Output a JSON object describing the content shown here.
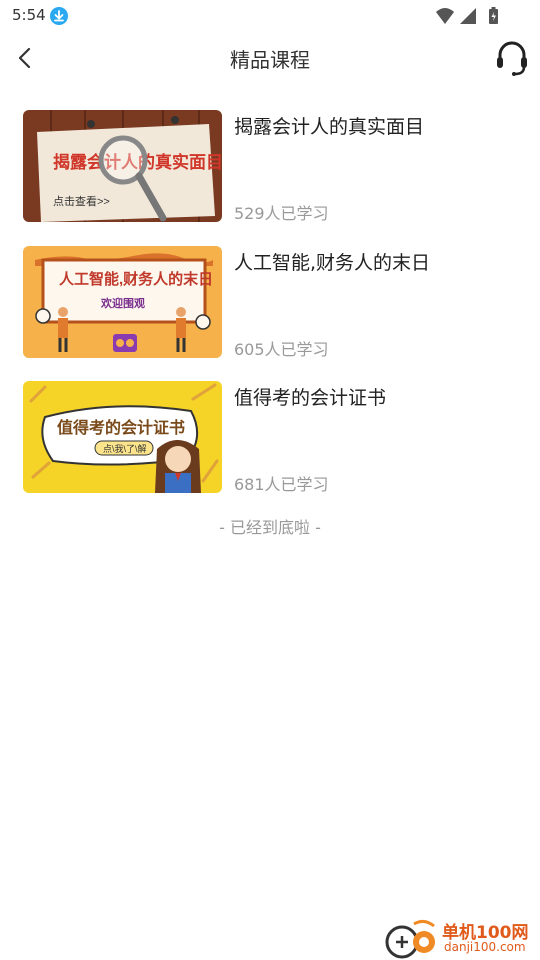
{
  "status_bar": {
    "time": "5:54"
  },
  "header": {
    "title": "精品课程"
  },
  "courses": [
    {
      "title": "揭露会计人的真实面目",
      "learners": "529人已学习",
      "thumb": {
        "headline": "揭露会计人的真实面目",
        "subtext": "点击查看>>"
      }
    },
    {
      "title": "人工智能,财务人的末日",
      "learners": "605人已学习",
      "thumb": {
        "headline": "人工智能,财务人的末日",
        "subtext": "欢迎围观"
      }
    },
    {
      "title": "值得考的会计证书",
      "learners": "681人已学习",
      "thumb": {
        "headline": "值得考的会计证书",
        "subtext": "点\\我\\了\\解"
      }
    }
  ],
  "end_tip": "- 已经到底啦 -",
  "watermark": {
    "name": "单机100网",
    "url": "danji100.com"
  }
}
